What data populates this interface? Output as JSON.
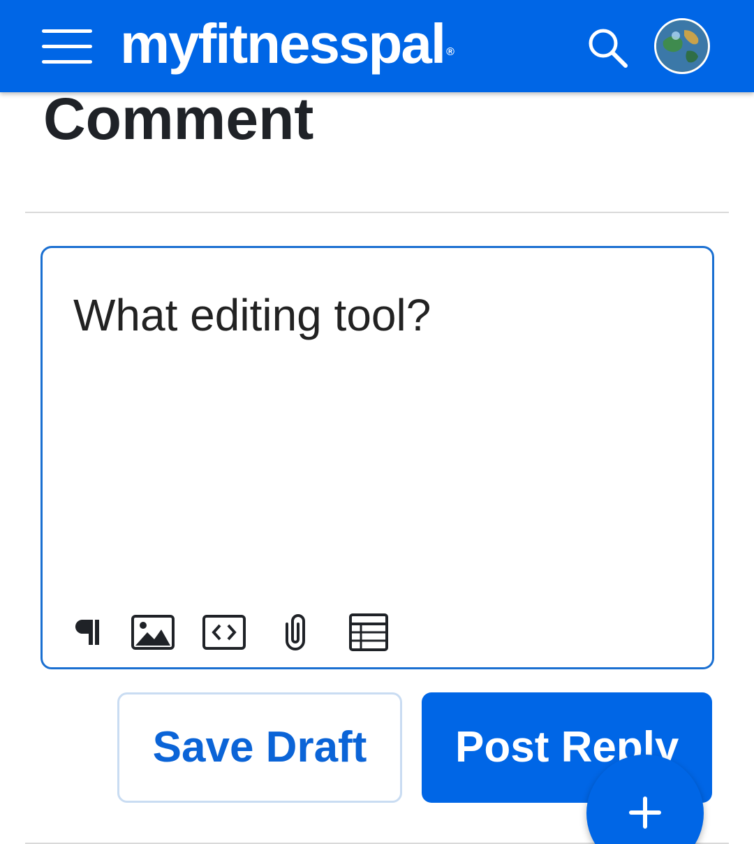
{
  "header": {
    "brand": "myfitnesspal",
    "brand_mark": "®",
    "menu_icon": "hamburger-menu-icon",
    "search_icon": "search-icon",
    "avatar": "user-avatar",
    "bar_color": "#0066e6"
  },
  "page": {
    "heading": "Comment"
  },
  "editor": {
    "text": "What editing tool?",
    "border_color": "#1a6fd1",
    "toolbar": [
      {
        "name": "paragraph-format",
        "icon": "pilcrow-icon"
      },
      {
        "name": "insert-image",
        "icon": "image-icon"
      },
      {
        "name": "insert-code",
        "icon": "code-icon"
      },
      {
        "name": "attach-file",
        "icon": "paperclip-icon"
      },
      {
        "name": "insert-table",
        "icon": "table-icon"
      }
    ]
  },
  "actions": {
    "save_draft": "Save Draft",
    "post_reply": "Post Reply",
    "fab_icon": "plus-icon"
  }
}
